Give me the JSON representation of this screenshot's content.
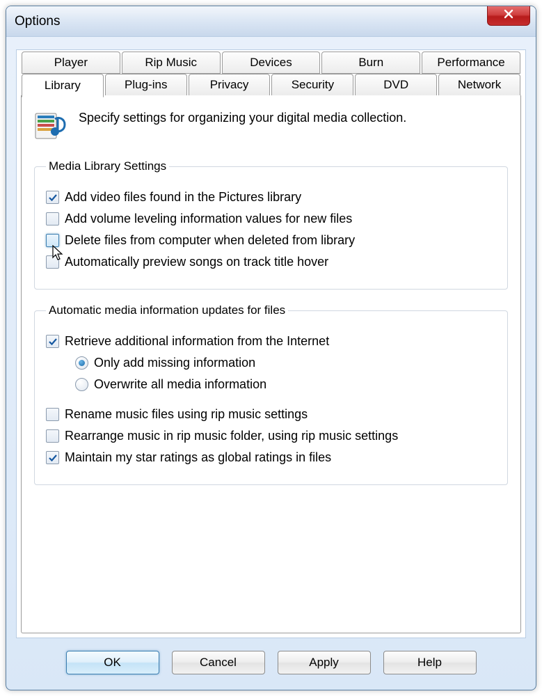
{
  "window": {
    "title": "Options"
  },
  "tabs_row1": [
    "Player",
    "Rip Music",
    "Devices",
    "Burn",
    "Performance"
  ],
  "tabs_row2": [
    "Library",
    "Plug-ins",
    "Privacy",
    "Security",
    "DVD",
    "Network"
  ],
  "active_tab": "Library",
  "header": {
    "text": "Specify settings for organizing your digital media collection."
  },
  "group1": {
    "legend": "Media Library Settings",
    "items": [
      {
        "label": "Add video files found in the Pictures library",
        "checked": true
      },
      {
        "label": "Add volume leveling information values for new files",
        "checked": false
      },
      {
        "label": "Delete files from computer when deleted from library",
        "checked": false,
        "hover": true
      },
      {
        "label": "Automatically preview songs on track title hover",
        "checked": false
      }
    ]
  },
  "group2": {
    "legend": "Automatic media information updates for files",
    "retrieve": {
      "label": "Retrieve additional information from the Internet",
      "checked": true
    },
    "radios": [
      {
        "label": "Only add missing information",
        "selected": true
      },
      {
        "label": "Overwrite all media information",
        "selected": false
      }
    ],
    "more": [
      {
        "label": "Rename music files using rip music settings",
        "checked": false
      },
      {
        "label": "Rearrange music in rip music folder, using rip music settings",
        "checked": false
      },
      {
        "label": "Maintain my star ratings as global ratings in files",
        "checked": true
      }
    ]
  },
  "buttons": {
    "ok": "OK",
    "cancel": "Cancel",
    "apply": "Apply",
    "help": "Help"
  }
}
